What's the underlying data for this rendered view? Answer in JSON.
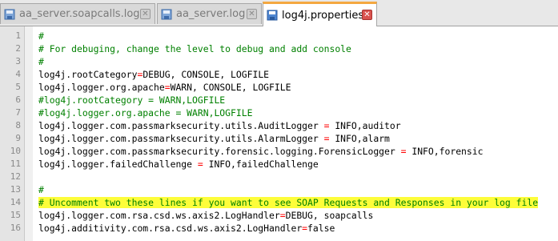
{
  "tabs": [
    {
      "label": "aa_server.soapcalls.log",
      "active": false,
      "icon": "log-file-icon"
    },
    {
      "label": "aa_server.log",
      "active": false,
      "icon": "log-file-icon"
    },
    {
      "label": "log4j.properties",
      "active": true,
      "icon": "save-file-icon"
    }
  ],
  "close_glyph": "✕",
  "lines": [
    {
      "n": "1",
      "type": "comment",
      "text": "#"
    },
    {
      "n": "2",
      "type": "comment",
      "text": "# For debuging, change the level to debug and add console"
    },
    {
      "n": "3",
      "type": "comment",
      "text": "#"
    },
    {
      "n": "4",
      "type": "prop",
      "key": "log4j.rootCategory",
      "eq": "=",
      "val": "DEBUG, CONSOLE, LOGFILE"
    },
    {
      "n": "5",
      "type": "prop",
      "key": "log4j.logger.org.apache",
      "eq": "=",
      "val": "WARN, CONSOLE, LOGFILE"
    },
    {
      "n": "6",
      "type": "comment",
      "text": "#log4j.rootCategory = WARN,LOGFILE"
    },
    {
      "n": "7",
      "type": "comment",
      "text": "#log4j.logger.org.apache = WARN,LOGFILE"
    },
    {
      "n": "8",
      "type": "prop",
      "key": "log4j.logger.com.passmarksecurity.utils.AuditLogger ",
      "eq": "=",
      "val": " INFO,auditor"
    },
    {
      "n": "9",
      "type": "prop",
      "key": "log4j.logger.com.passmarksecurity.utils.AlarmLogger ",
      "eq": "=",
      "val": " INFO,alarm"
    },
    {
      "n": "10",
      "type": "prop",
      "key": "log4j.logger.com.passmarksecurity.forensic.logging.ForensicLogger ",
      "eq": "=",
      "val": " INFO,forensic"
    },
    {
      "n": "11",
      "type": "prop",
      "key": "log4j.logger.failedChallenge ",
      "eq": "=",
      "val": " INFO,failedChallenge"
    },
    {
      "n": "12",
      "type": "empty",
      "text": ""
    },
    {
      "n": "13",
      "type": "comment",
      "text": "#"
    },
    {
      "n": "14",
      "type": "comment",
      "highlight": true,
      "text": "# Uncomment two these lines if you want to see SOAP Requests and Responses in your log file"
    },
    {
      "n": "15",
      "type": "prop",
      "key": "log4j.logger.com.rsa.csd.ws.axis2.LogHandler",
      "eq": "=",
      "val": "DEBUG, soapcalls"
    },
    {
      "n": "16",
      "type": "prop",
      "key": "log4j.additivity.com.rsa.csd.ws.axis2.LogHandler",
      "eq": "=",
      "val": "false"
    }
  ],
  "colors": {
    "comment": "#008000",
    "operator": "#ff0000",
    "highlight": "#fdfd3a",
    "active_tab_accent": "#f4a840"
  }
}
